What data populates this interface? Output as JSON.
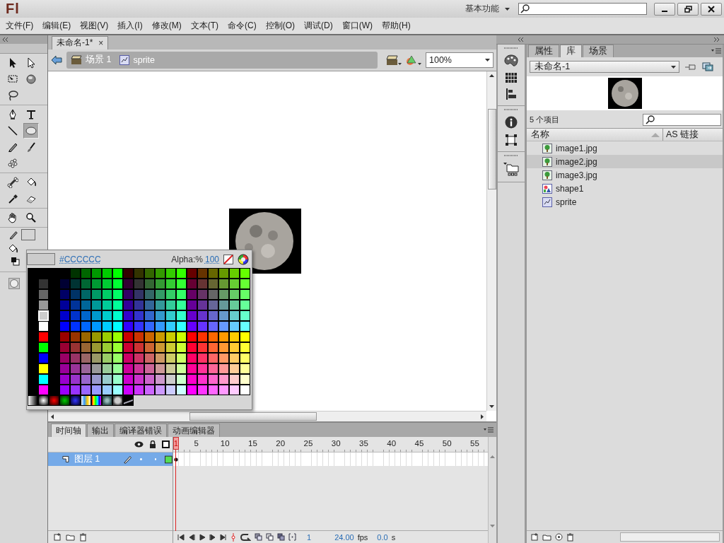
{
  "title_bar": {
    "logo": "Fl",
    "workspace": "基本功能"
  },
  "menu": [
    "文件(F)",
    "编辑(E)",
    "视图(V)",
    "插入(I)",
    "修改(M)",
    "文本(T)",
    "命令(C)",
    "控制(O)",
    "调试(D)",
    "窗口(W)",
    "帮助(H)"
  ],
  "toolbox": {
    "groups": [
      {
        "tools": [
          {
            "kind": "selection",
            "selected": false
          },
          {
            "kind": "subselection",
            "selected": false
          },
          {
            "kind": "free-transform",
            "selected": false
          },
          {
            "kind": "rotation-3d",
            "selected": false
          },
          {
            "kind": "lasso",
            "selected": false
          }
        ]
      },
      {
        "tools": [
          {
            "kind": "pen",
            "selected": false
          },
          {
            "kind": "text",
            "selected": false
          },
          {
            "kind": "line",
            "selected": false
          },
          {
            "kind": "oval",
            "selected": true
          },
          {
            "kind": "pencil",
            "selected": false
          },
          {
            "kind": "brush",
            "selected": false
          },
          {
            "kind": "deco",
            "selected": false
          }
        ]
      },
      {
        "tools": [
          {
            "kind": "bone",
            "selected": false
          },
          {
            "kind": "bucket",
            "selected": false
          },
          {
            "kind": "eyedropper",
            "selected": false
          },
          {
            "kind": "eraser",
            "selected": false
          }
        ]
      },
      {
        "tools": [
          {
            "kind": "hand",
            "selected": false
          },
          {
            "kind": "zoom",
            "selected": false
          }
        ]
      }
    ]
  },
  "document": {
    "tab": "未命名-1*",
    "close": "×",
    "breadcrumbs": [
      {
        "label": "场景 1",
        "kind": "scene"
      },
      {
        "label": "sprite",
        "kind": "symbol"
      }
    ],
    "zoom": "100%"
  },
  "color_picker": {
    "color": "#cccccc",
    "hex": "#CCCCCC",
    "alpha_label": "Alpha:%",
    "alpha": "100"
  },
  "timeline": {
    "tabs": [
      {
        "label": "时间轴",
        "selected": true
      },
      {
        "label": "输出",
        "selected": false
      },
      {
        "label": "编译器错误",
        "selected": false
      },
      {
        "label": "动画编辑器",
        "selected": false
      }
    ],
    "playhead": "1",
    "frame_numbers": [
      "5",
      "10",
      "15",
      "20",
      "25",
      "30",
      "35",
      "40",
      "45",
      "50",
      "55"
    ],
    "layers": [
      {
        "name": "图层 1",
        "selected": true
      }
    ],
    "current_frame": "1",
    "fps": "24.00",
    "fps_unit": "fps",
    "time": "0.0",
    "time_unit": "s"
  },
  "library": {
    "tabs": [
      {
        "label": "属性",
        "selected": false
      },
      {
        "label": "库",
        "selected": true
      },
      {
        "label": "场景",
        "selected": false
      }
    ],
    "document": "未命名-1",
    "count": "5 个项目",
    "columns": [
      "名称",
      "AS 链接"
    ],
    "items": [
      {
        "name": "image1.jpg",
        "kind": "bitmap",
        "selected": false
      },
      {
        "name": "image2.jpg",
        "kind": "bitmap",
        "selected": true
      },
      {
        "name": "image3.jpg",
        "kind": "bitmap",
        "selected": false
      },
      {
        "name": "shape1",
        "kind": "graphic",
        "selected": false
      },
      {
        "name": "sprite",
        "kind": "movieclip",
        "selected": false
      }
    ]
  }
}
